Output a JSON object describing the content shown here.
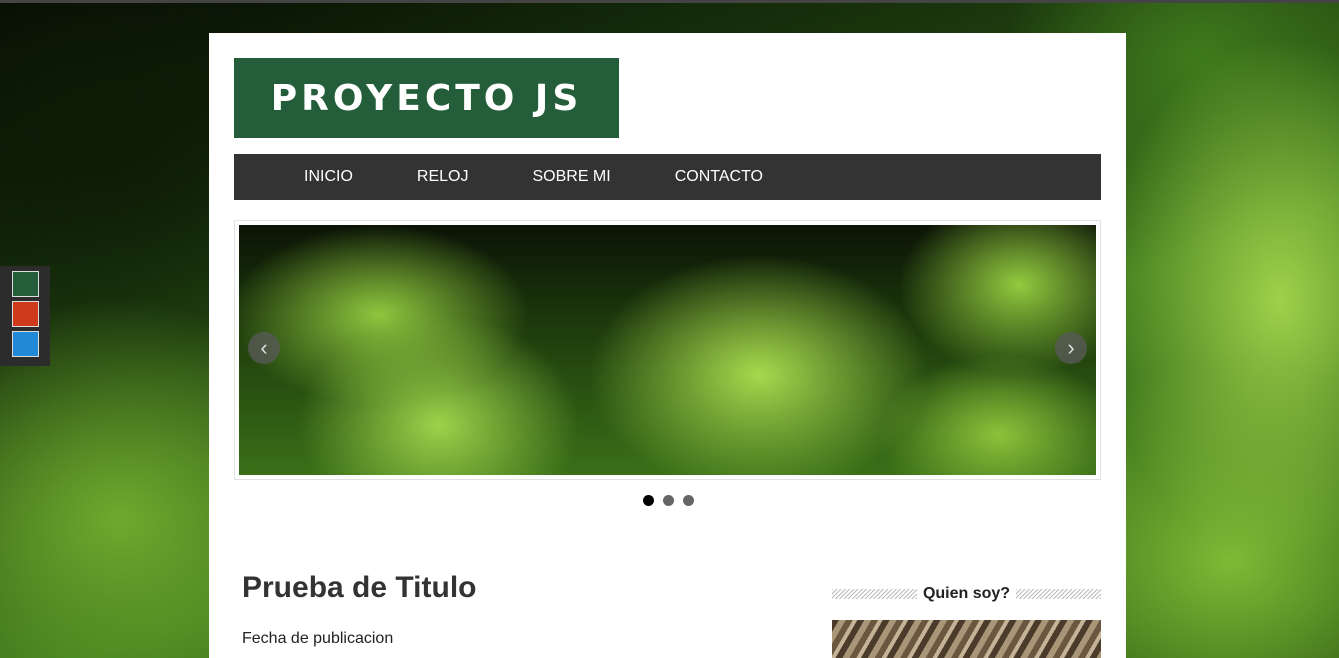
{
  "header": {
    "logo_text": "PROYECTO JS"
  },
  "nav": {
    "items": [
      "INICIO",
      "RELOJ",
      "SOBRE MI",
      "CONTACTO"
    ]
  },
  "slider": {
    "prev_icon": "chevron-left-icon",
    "next_icon": "chevron-right-icon",
    "prev_glyph": "‹",
    "next_glyph": "›",
    "slide_count": 3,
    "active_index": 0
  },
  "post": {
    "title": "Prueba de Titulo",
    "date_label": "Fecha de publicacion"
  },
  "sidebar": {
    "widget_title": "Quien soy?"
  },
  "theme_switcher": {
    "colors": [
      "#235d3a",
      "#cf3a1d",
      "#2289d6"
    ]
  },
  "colors": {
    "brand_green": "#235d3a",
    "nav_bg": "#333333"
  }
}
